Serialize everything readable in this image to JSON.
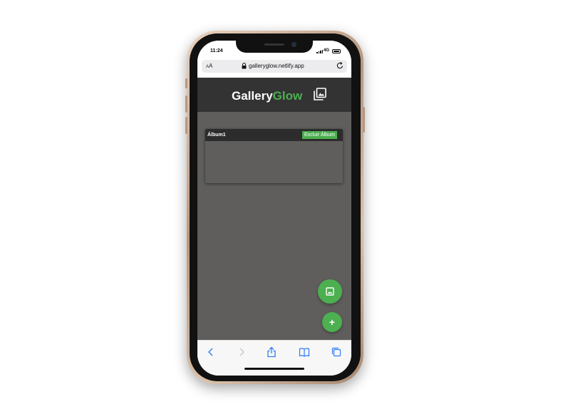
{
  "status_bar": {
    "time": "11:24",
    "network": "4G"
  },
  "browser": {
    "text_size_label_small": "A",
    "text_size_label_large": "A",
    "url": "galleryglow.netlify.app"
  },
  "app": {
    "brand_part1": "Gallery",
    "brand_part2": "Glow",
    "icon": "photo-library-icon"
  },
  "albums": [
    {
      "title": "Álbum1",
      "delete_label": "Excluir Álbum"
    }
  ],
  "fabs": {
    "image_icon": "image-icon",
    "add_label": "+"
  },
  "toolbar": {
    "icons": [
      "back-icon",
      "forward-icon",
      "share-icon",
      "bookmarks-icon",
      "tabs-icon"
    ]
  },
  "colors": {
    "accent": "#4caf50",
    "header": "#333333",
    "background": "#5f5e5c",
    "ios_blue": "#2f7cf6"
  }
}
